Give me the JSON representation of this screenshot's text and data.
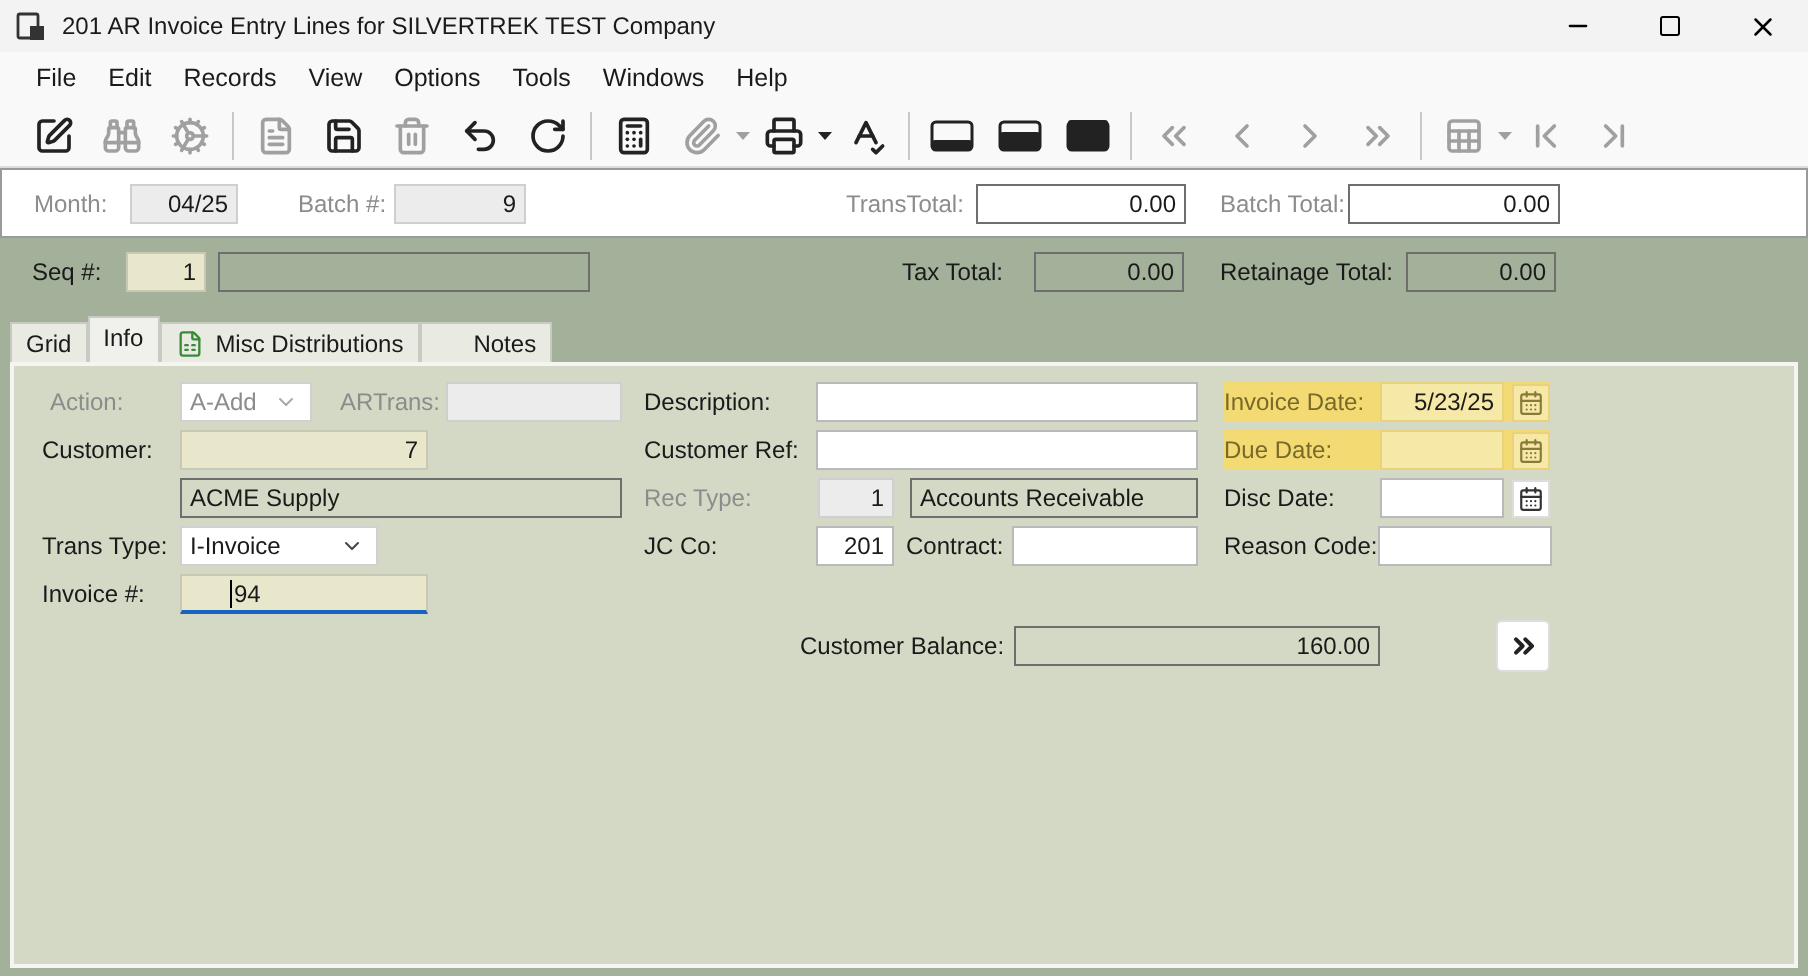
{
  "window": {
    "title": "201 AR Invoice Entry Lines for SILVERTREK TEST Company"
  },
  "menu": [
    "File",
    "Edit",
    "Records",
    "View",
    "Options",
    "Tools",
    "Windows",
    "Help"
  ],
  "toolbar": [
    {
      "kind": "edit",
      "disabled": false
    },
    {
      "kind": "find",
      "disabled": true
    },
    {
      "kind": "process",
      "disabled": true
    },
    {
      "kind": "sep"
    },
    {
      "kind": "new",
      "disabled": true
    },
    {
      "kind": "save",
      "disabled": false
    },
    {
      "kind": "delete",
      "disabled": true
    },
    {
      "kind": "undo",
      "disabled": false
    },
    {
      "kind": "refresh",
      "disabled": false
    },
    {
      "kind": "sep"
    },
    {
      "kind": "calculator",
      "disabled": false
    },
    {
      "kind": "attach",
      "disabled": true
    },
    {
      "kind": "print",
      "disabled": false
    },
    {
      "kind": "spell",
      "disabled": false
    },
    {
      "kind": "sep"
    },
    {
      "kind": "layout1"
    },
    {
      "kind": "layout2"
    },
    {
      "kind": "layout3"
    },
    {
      "kind": "sep"
    },
    {
      "kind": "first",
      "disabled": true
    },
    {
      "kind": "prev",
      "disabled": true
    },
    {
      "kind": "next",
      "disabled": true
    },
    {
      "kind": "last",
      "disabled": true
    },
    {
      "kind": "sep"
    },
    {
      "kind": "grid",
      "disabled": true
    },
    {
      "kind": "start",
      "disabled": true
    },
    {
      "kind": "end",
      "disabled": true
    }
  ],
  "header": {
    "month": {
      "label": "Month:",
      "value": "04/25"
    },
    "batch": {
      "label": "Batch #:",
      "value": "9"
    },
    "trans_total": {
      "label": "TransTotal:",
      "value": "0.00"
    },
    "batch_total": {
      "label": "Batch Total:",
      "value": "0.00"
    }
  },
  "seq": {
    "label": "Seq #:",
    "value": "1"
  },
  "tax_total": {
    "label": "Tax Total:",
    "value": "0.00"
  },
  "retainage_total": {
    "label": "Retainage Total:",
    "value": "0.00"
  },
  "tabs": [
    {
      "label": "Grid",
      "selected": false
    },
    {
      "label": "Info",
      "selected": true
    },
    {
      "label": "Misc Distributions",
      "selected": false,
      "icon": true
    },
    {
      "label": "Notes",
      "selected": false
    }
  ],
  "info": {
    "action": {
      "label": "Action:",
      "value": "A-Add",
      "disabled": true
    },
    "artrans": {
      "label": "ARTrans:",
      "disabled": true
    },
    "description": {
      "label": "Description:"
    },
    "invoice_date": {
      "label": "Invoice Date:",
      "value": "5/23/25",
      "highlighted": true
    },
    "customer": {
      "label": "Customer:",
      "value": "7"
    },
    "customer_ref": {
      "label": "Customer Ref:"
    },
    "due_date": {
      "label": "Due Date:",
      "highlighted": true
    },
    "customer_name": {
      "value": "ACME Supply"
    },
    "rec_type": {
      "label": "Rec Type:",
      "value": "1",
      "disabled": true
    },
    "rec_type_name": {
      "value": "Accounts Receivable"
    },
    "disc_date": {
      "label": "Disc Date:",
      "highlighted": false
    },
    "trans_type": {
      "label": "Trans Type:",
      "value": "I-Invoice"
    },
    "jc_co": {
      "label": "JC Co:",
      "value": "201"
    },
    "contract": {
      "label": "Contract:"
    },
    "reason_code": {
      "label": "Reason Code:"
    },
    "invoice_no": {
      "label": "Invoice #:",
      "value": "94",
      "focused": true
    },
    "customer_balance": {
      "label": "Customer Balance:",
      "value": "160.00"
    }
  }
}
